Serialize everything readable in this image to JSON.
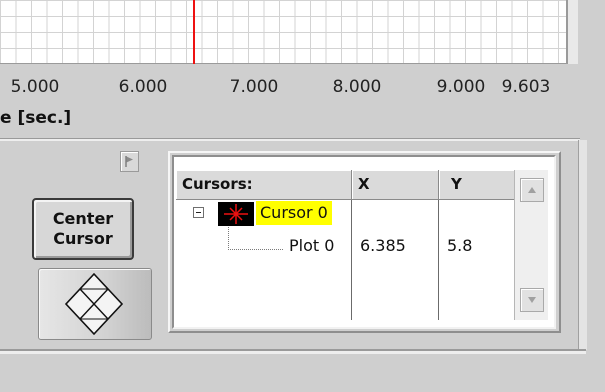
{
  "graph": {
    "x_ticks": [
      "5.000",
      "6.000",
      "7.000",
      "8.000",
      "9.000",
      "9.603"
    ],
    "x_axis_label": "e [sec.]",
    "cursor_color": "#e11111"
  },
  "controls": {
    "center_cursor_line1": "Center",
    "center_cursor_line2": "Cursor",
    "legend_toggle_icon": "flag-icon",
    "cursor_mover_icon": "diamond-arrows-icon"
  },
  "cursor_table": {
    "headers": {
      "name": "Cursors:",
      "x": "X",
      "y": "Y"
    },
    "cursor": {
      "name": "Cursor 0",
      "highlight_color": "#ffff00"
    },
    "row": {
      "plot": "Plot 0",
      "x": "6.385",
      "y": "5.8"
    }
  }
}
